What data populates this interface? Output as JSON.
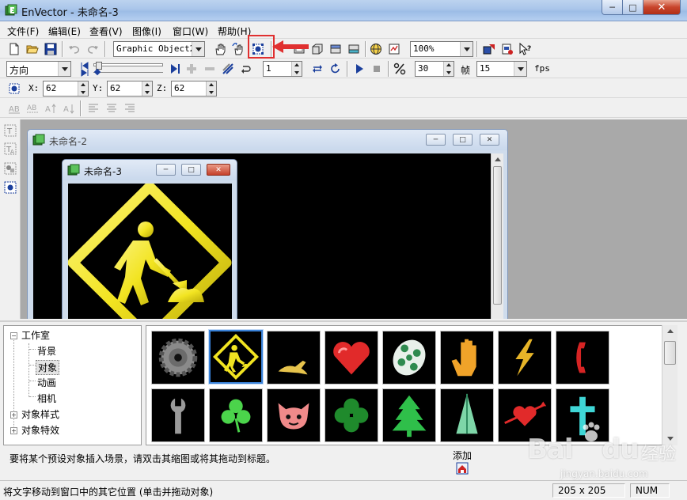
{
  "window": {
    "title": "EnVector - 未命名-3",
    "controls": {
      "minimize": "─",
      "maximize": "□",
      "close": "✕"
    }
  },
  "menu": [
    "文件(F)",
    "编辑(E)",
    "查看(V)",
    "图像(I)",
    "窗口(W)",
    "帮助(H)"
  ],
  "toolbar1": {
    "object_select": "Graphic Object2",
    "zoom": "100%"
  },
  "toolbar2": {
    "direction_select": "方向",
    "frame_value": "1",
    "percent_value": "30",
    "frame_label": "帧",
    "fps_value": "15",
    "fps_label": "fps"
  },
  "toolbar3": {
    "x_label": "X:",
    "x_value": "62",
    "y_label": "Y:",
    "y_value": "62",
    "z_label": "Z:",
    "z_value": "62"
  },
  "mdi": {
    "back_window_title": "未命名-2",
    "front_window_title": "未命名-3"
  },
  "tree": {
    "root": "工作室",
    "children": [
      "背景",
      "对象",
      "动画",
      "相机"
    ],
    "selected": "对象",
    "others": [
      "对象样式",
      "对象特效"
    ]
  },
  "gallery": {
    "items": [
      "gear",
      "construction-sign",
      "kangaroo",
      "heart",
      "film-reel",
      "hand",
      "lightning",
      "telephone",
      "wrench",
      "clover",
      "cat-face",
      "four-leaf-clover",
      "tree",
      "cone",
      "heart-arrow",
      "cross"
    ],
    "selected_index": 1
  },
  "hint": "要将某个预设对象插入场景，请双击其缩图或将其拖动到标题。",
  "add_button": {
    "label": "添加"
  },
  "status": {
    "text": "将文字移动到窗口中的其它位置 (单击并拖动对象)",
    "size": "205 x 205",
    "num": "NUM"
  },
  "watermark": {
    "brand": "Bai",
    "suffix": "du",
    "sub": "经验",
    "url": "jingyan.baidu.com"
  },
  "colors": {
    "highlight": "#e03030",
    "sign_yellow": "#f2e421",
    "canvas": "#000000"
  }
}
